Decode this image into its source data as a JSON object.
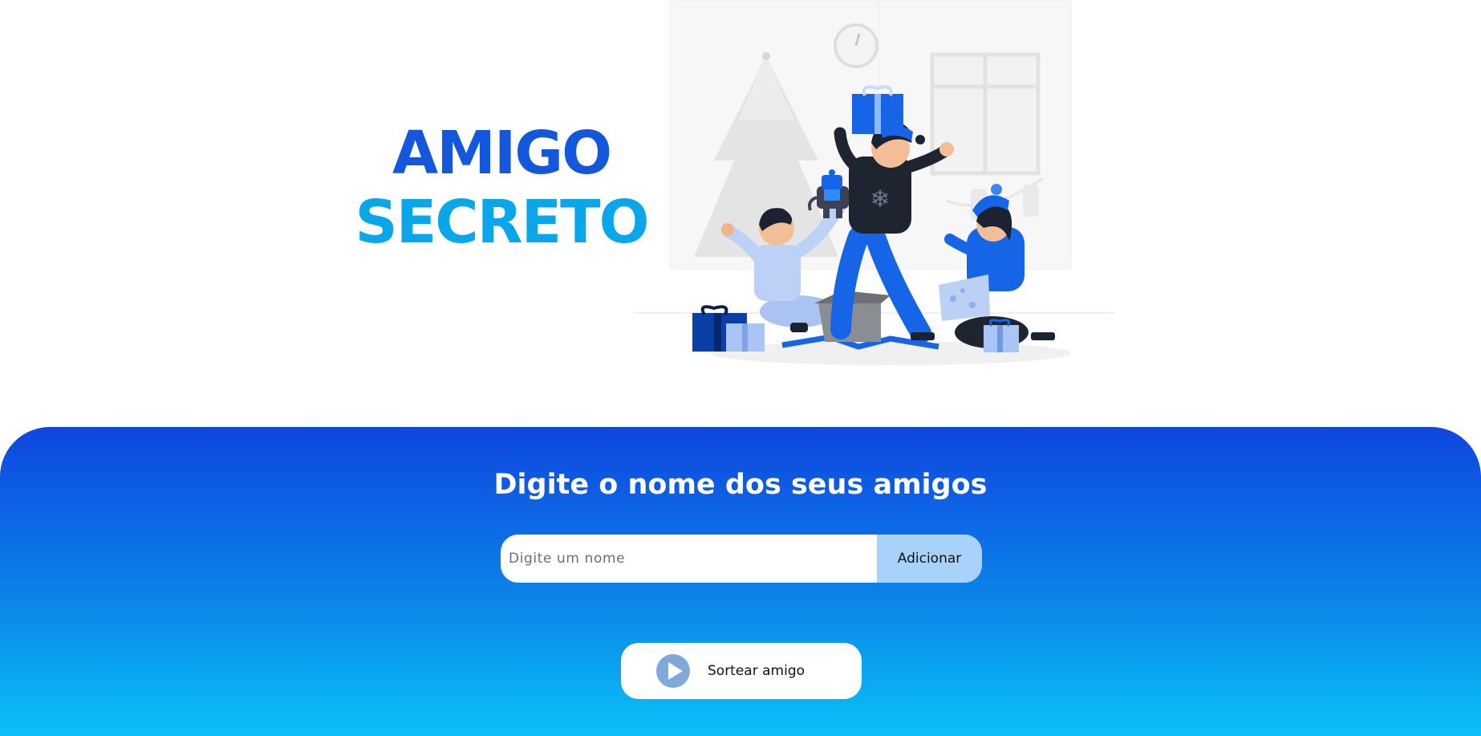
{
  "header": {
    "title_line1": "AMIGO",
    "title_line2": "SECRETO",
    "illustration_icon": "christmas-gift-exchange-illustration"
  },
  "main": {
    "section_title": "Digite o nome dos seus amigos",
    "input_placeholder": "Digite um nome",
    "input_value": "",
    "add_button_label": "Adicionar",
    "draw_button_label": "Sortear amigo",
    "draw_icon": "play-icon"
  },
  "colors": {
    "title_primary": "#1257dc",
    "title_secondary": "#0aa6ea",
    "gradient_top": "#0f46df",
    "gradient_bottom": "#0bc1f7",
    "add_button_bg": "#a9d2fb",
    "play_icon": "#7ea9d8"
  }
}
